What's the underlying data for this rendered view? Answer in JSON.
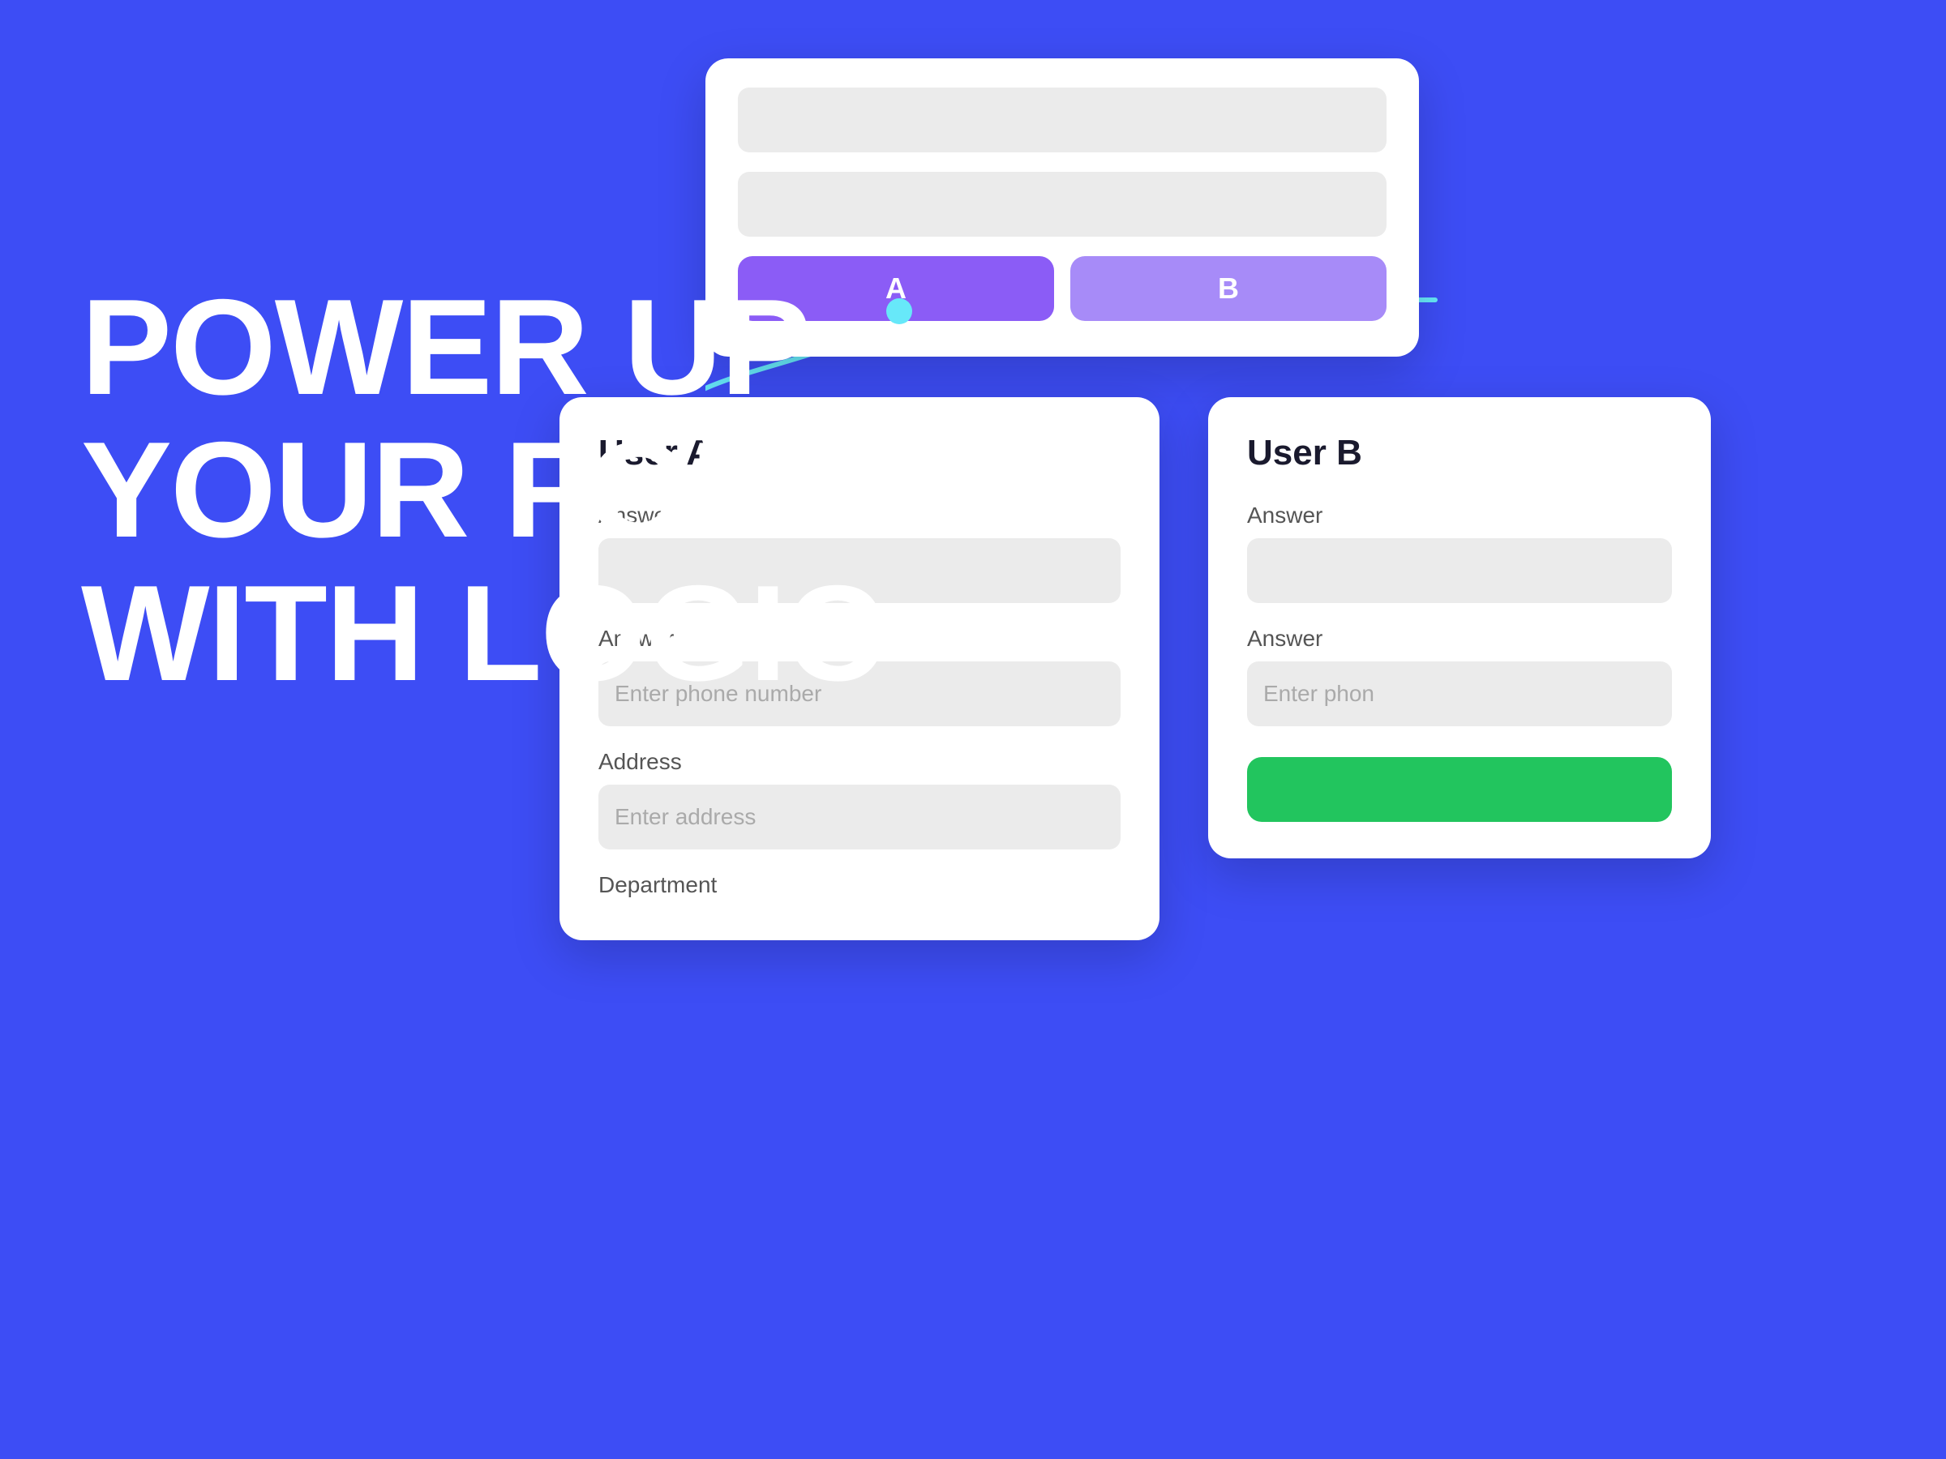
{
  "background_color": "#3d4df5",
  "hero": {
    "line1": "POWER UP",
    "line2": "YOUR FORM",
    "line3": "WITH LOGIC"
  },
  "top_card": {
    "field1_placeholder": "",
    "field2_placeholder": "",
    "button_a_label": "A",
    "button_b_label": "B"
  },
  "connector": {
    "dot_color": "#67e8f9",
    "line_color": "#67e8f9"
  },
  "user_a_card": {
    "title": "User A",
    "field1_label": "Answer",
    "field1_placeholder": "",
    "field2_label": "Answer",
    "field2_placeholder": "Enter phone number",
    "field3_label": "Address",
    "field3_placeholder": "Enter address",
    "field4_label": "Department"
  },
  "user_b_card": {
    "title": "User B",
    "field1_label": "Answer",
    "field1_placeholder": "",
    "field2_label": "Answer",
    "field2_placeholder": "Enter phon",
    "button_color": "#22c55e"
  }
}
